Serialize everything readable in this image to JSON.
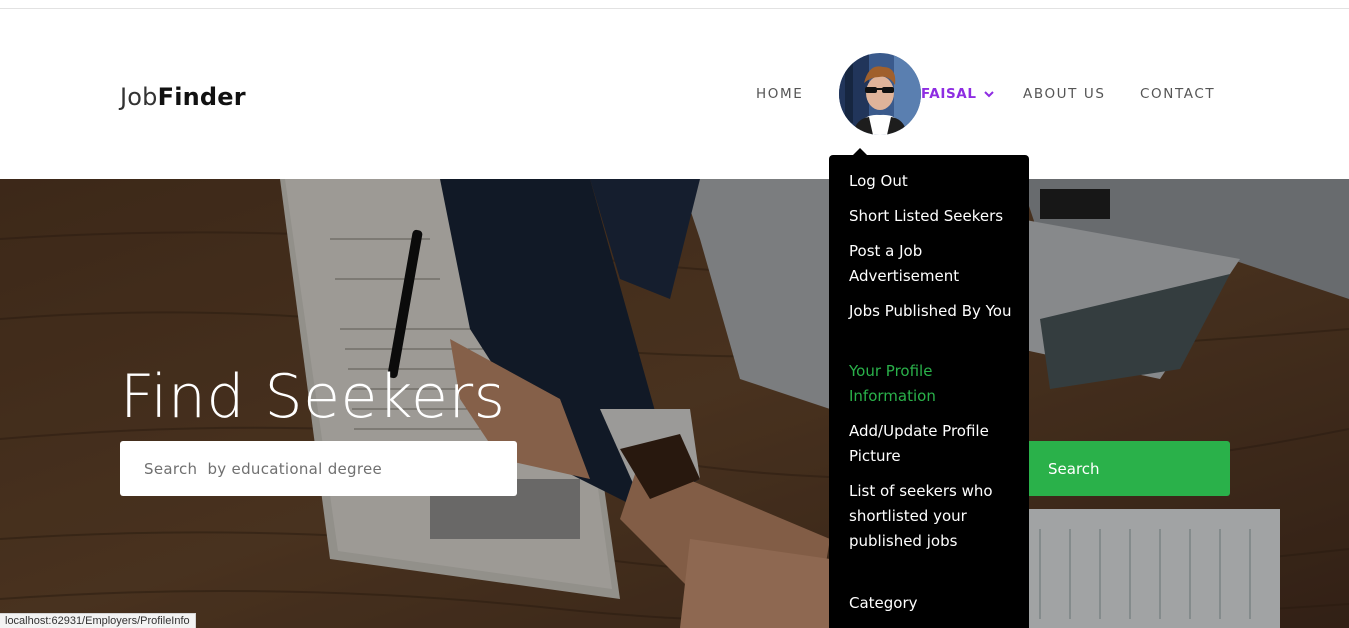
{
  "brand": {
    "part1": "Job",
    "part2": "Finder"
  },
  "nav": {
    "home": "HOME",
    "user": "FAISAL",
    "about": "ABOUT US",
    "contact": "CONTACT"
  },
  "hero": {
    "title": "Find Seekers",
    "search_placeholder": "Search  by educational degree",
    "search_button": "Search"
  },
  "dropdown": {
    "items": [
      "Log Out",
      "Short Listed Seekers",
      "Post a Job Advertisement",
      "Jobs Published By You",
      "Your Profile Information",
      "Add/Update Profile Picture",
      "List of seekers who shortlisted your published jobs",
      "Category"
    ],
    "active_item": "Your Profile Information"
  },
  "status_bar": {
    "url": "localhost:62931/Employers/ProfileInfo"
  },
  "colors": {
    "accent": "#8e2de2",
    "green": "#2ab14a",
    "dropdown_bg": "#000000"
  }
}
